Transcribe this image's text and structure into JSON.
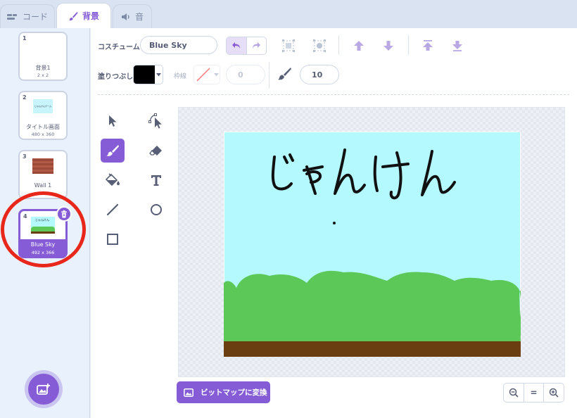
{
  "tabs": [
    {
      "label": "コード",
      "icon": "code-icon"
    },
    {
      "label": "背景",
      "icon": "brush-icon"
    },
    {
      "label": "音",
      "icon": "speaker-icon"
    }
  ],
  "costumes": [
    {
      "num": "1",
      "name": "背景1",
      "size": "2 x 2"
    },
    {
      "num": "2",
      "name": "タイトル画面",
      "size": "480 x 360",
      "thumb_text": "じゃんけんゲーム"
    },
    {
      "num": "3",
      "name": "Wall 1",
      "size": ""
    },
    {
      "num": "4",
      "name": "Blue Sky",
      "size": "492 x 366",
      "selected": true,
      "thumb_text": "じゃんけん"
    }
  ],
  "toolbar": {
    "costume_label": "コスチューム",
    "costume_name": "Blue Sky",
    "fill_label": "塗りつぶし",
    "outline_label": "枠線",
    "outline_width": "0",
    "brush_size": "10"
  },
  "canvas": {
    "handwritten_text": "じゃんけん"
  },
  "convert_button": "ビットマップに変換",
  "zoom": {
    "out": "−",
    "reset": "=",
    "in": "+"
  },
  "colors": {
    "accent": "#855cd6",
    "fill": "#000000",
    "sky": "#b3f9fe",
    "grass": "#5cc858",
    "ground": "#6b3e12",
    "highlight_ring": "#e8261a"
  }
}
